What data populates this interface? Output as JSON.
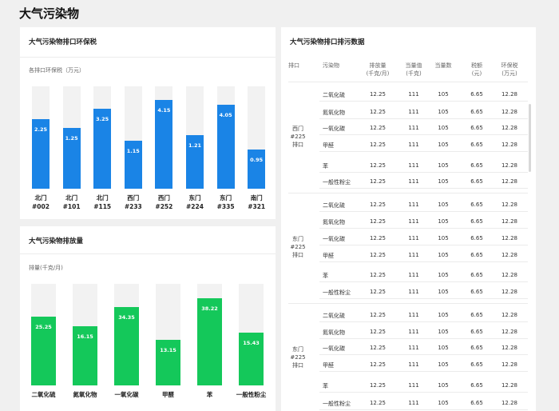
{
  "page": {
    "title": "大气污染物"
  },
  "tax_chart": {
    "title": "大气污染物排口环保税",
    "sublabel": "各排口环保税（万元）",
    "color": "#1a84e6",
    "bars": [
      {
        "label": "北门\n#002",
        "value": "2.25",
        "fraction": 0.68
      },
      {
        "label": "北门\n#101",
        "value": "1.25",
        "fraction": 0.59
      },
      {
        "label": "北门\n#115",
        "value": "3.25",
        "fraction": 0.78
      },
      {
        "label": "西门\n#233",
        "value": "1.15",
        "fraction": 0.47
      },
      {
        "label": "西门\n#252",
        "value": "4.15",
        "fraction": 0.87
      },
      {
        "label": "东门\n#224",
        "value": "1.21",
        "fraction": 0.52
      },
      {
        "label": "东门\n#335",
        "value": "4.05",
        "fraction": 0.82
      },
      {
        "label": "南门\n#321",
        "value": "0.95",
        "fraction": 0.38
      }
    ]
  },
  "emission_chart": {
    "title": "大气污染物排放量",
    "sublabel": "排量(千克/月)",
    "color": "#14c85a",
    "bars": [
      {
        "label": "二氧化硫",
        "value": "25.25",
        "fraction": 0.68
      },
      {
        "label": "氮氧化物",
        "value": "16.15",
        "fraction": 0.58
      },
      {
        "label": "一氧化碳",
        "value": "34.35",
        "fraction": 0.77
      },
      {
        "label": "甲醛",
        "value": "13.15",
        "fraction": 0.45
      },
      {
        "label": "苯",
        "value": "38.22",
        "fraction": 0.86
      },
      {
        "label": "一般性粉尘",
        "value": "15.43",
        "fraction": 0.52
      }
    ]
  },
  "table_card": {
    "title": "大气污染物排口排污数据",
    "headers": [
      "排口",
      "污染物",
      "排放量\n(千克/月)",
      "当量值\n(千克)",
      "当量数",
      "税额\n(元)",
      "环保税\n(万元)"
    ],
    "groups": [
      {
        "outlet": "西门\n#225\n排口",
        "rows": [
          [
            "二氧化硫",
            "12.25",
            "111",
            "105",
            "6.65",
            "12.28"
          ],
          [
            "氮氧化物",
            "12.25",
            "111",
            "105",
            "6.65",
            "12.28"
          ],
          [
            "一氧化碳",
            "12.25",
            "111",
            "105",
            "6.65",
            "12.28"
          ],
          [
            "甲醛",
            "12.25",
            "111",
            "105",
            "6.65",
            "12.28"
          ],
          [
            "苯",
            "12.25",
            "111",
            "105",
            "6.65",
            "12.28"
          ],
          [
            "一般性粉尘",
            "12.25",
            "111",
            "105",
            "6.65",
            "12.28"
          ]
        ]
      },
      {
        "outlet": "东门\n#225\n排口",
        "rows": [
          [
            "二氧化硫",
            "12.25",
            "111",
            "105",
            "6.65",
            "12.28"
          ],
          [
            "氮氧化物",
            "12.25",
            "111",
            "105",
            "6.65",
            "12.28"
          ],
          [
            "一氧化碳",
            "12.25",
            "111",
            "105",
            "6.65",
            "12.28"
          ],
          [
            "甲醛",
            "12.25",
            "111",
            "105",
            "6.65",
            "12.28"
          ],
          [
            "苯",
            "12.25",
            "111",
            "105",
            "6.65",
            "12.28"
          ],
          [
            "一般性粉尘",
            "12.25",
            "111",
            "105",
            "6.65",
            "12.28"
          ]
        ]
      },
      {
        "outlet": "东门\n#225\n排口",
        "rows": [
          [
            "二氧化硫",
            "12.25",
            "111",
            "105",
            "6.65",
            "12.28"
          ],
          [
            "氮氧化物",
            "12.25",
            "111",
            "105",
            "6.65",
            "12.28"
          ],
          [
            "一氧化碳",
            "12.25",
            "111",
            "105",
            "6.65",
            "12.28"
          ],
          [
            "甲醛",
            "12.25",
            "111",
            "105",
            "6.65",
            "12.28"
          ],
          [
            "苯",
            "12.25",
            "111",
            "105",
            "6.65",
            "12.28"
          ],
          [
            "一般性粉尘",
            "12.25",
            "111",
            "105",
            "6.65",
            "12.28"
          ]
        ]
      }
    ]
  }
}
